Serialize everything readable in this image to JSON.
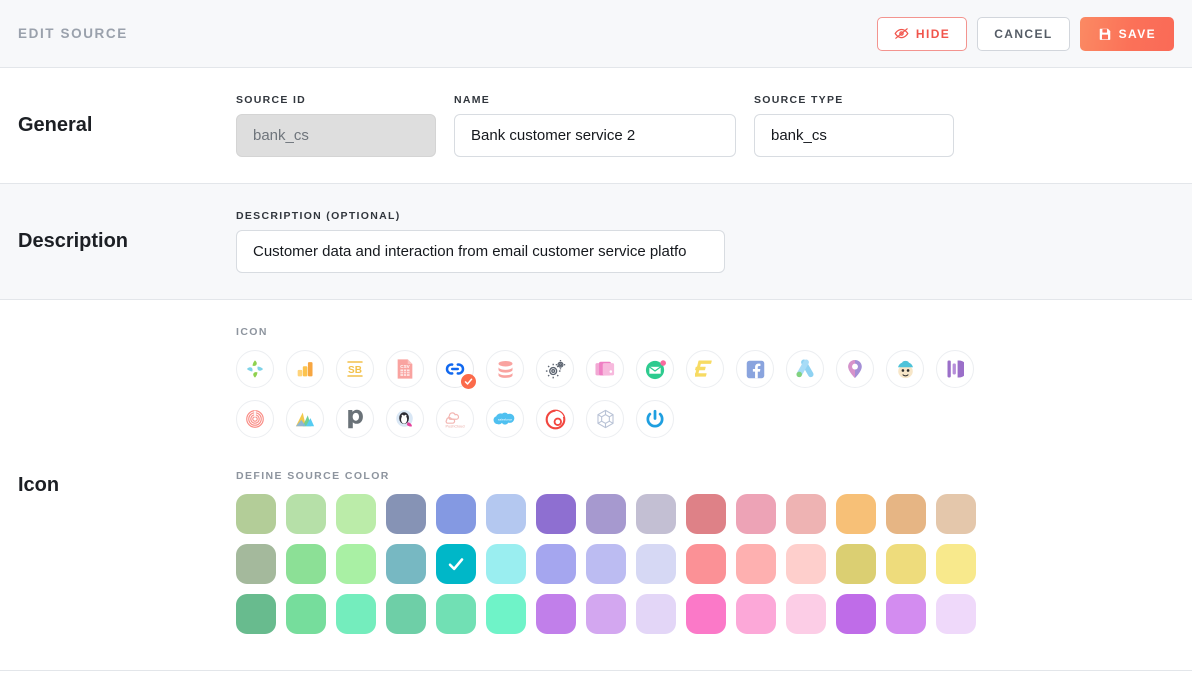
{
  "header": {
    "title": "EDIT SOURCE",
    "buttons": {
      "hide": "HIDE",
      "cancel": "CANCEL",
      "save": "SAVE"
    },
    "icons": {
      "hide": "eye-slash-icon",
      "save": "floppy-disk-icon"
    },
    "colors": {
      "hide_accent": "#f1554c",
      "save_gradient_from": "#fb8a63",
      "save_gradient_to": "#fa6a57"
    }
  },
  "sections": {
    "general": {
      "label": "General",
      "fields": {
        "source_id": {
          "label": "SOURCE ID",
          "value": "bank_cs",
          "disabled": true
        },
        "name": {
          "label": "NAME",
          "value": "Bank customer service 2",
          "disabled": false
        },
        "source_type": {
          "label": "SOURCE TYPE",
          "value": "bank_cs",
          "disabled": false
        }
      }
    },
    "description": {
      "label": "Description",
      "field": {
        "label": "DESCRIPTION (OPTIONAL)",
        "value": "Customer data and interaction from email customer service platfo"
      }
    },
    "icon": {
      "label": "Icon",
      "icon_picker_label": "ICON",
      "color_picker_label": "DEFINE SOURCE COLOR",
      "selected_icon_index": 4,
      "icons": [
        {
          "name": "leaf-cluster-icon",
          "title": "Leaf cluster"
        },
        {
          "name": "bar-chart-icon",
          "title": "Bar chart"
        },
        {
          "name": "sb-letters-icon",
          "title": "SB"
        },
        {
          "name": "csv-file-icon",
          "title": "CSV file"
        },
        {
          "name": "oc-logo-icon",
          "title": "OC logo"
        },
        {
          "name": "database-icon",
          "title": "Database"
        },
        {
          "name": "gears-icon",
          "title": "Gears"
        },
        {
          "name": "cards-stack-icon",
          "title": "Cards stack"
        },
        {
          "name": "envelope-icon",
          "title": "Envelope"
        },
        {
          "name": "e-letter-icon",
          "title": "E letter"
        },
        {
          "name": "facebook-icon",
          "title": "Facebook"
        },
        {
          "name": "google-ads-icon",
          "title": "Google Ads"
        },
        {
          "name": "map-pin-icon",
          "title": "Map pin"
        },
        {
          "name": "mailchimp-icon",
          "title": "Mailchimp"
        },
        {
          "name": "bars-pillar-icon",
          "title": "Pillars"
        },
        {
          "name": "spiral-icon",
          "title": "Spiral"
        },
        {
          "name": "mountain-chart-icon",
          "title": "Mountain chart"
        },
        {
          "name": "pipedrive-p-icon",
          "title": "Pipedrive"
        },
        {
          "name": "prestashop-icon",
          "title": "PrestaShop"
        },
        {
          "name": "pushcloud-icon",
          "title": "PushCloud"
        },
        {
          "name": "salesforce-icon",
          "title": "Salesforce"
        },
        {
          "name": "red-ring-icon",
          "title": "Red ring"
        },
        {
          "name": "hexagon-icon",
          "title": "Hexagon"
        },
        {
          "name": "power-button-icon",
          "title": "Power"
        }
      ],
      "selected_color_index": 19,
      "selected_color": "#00b7c8",
      "colors": [
        "#b3cd98",
        "#b6e0a8",
        "#bbeca9",
        "#8693b5",
        "#8499e2",
        "#b4c8f0",
        "#8e6fd1",
        "#a699cf",
        "#c3bfd3",
        "#de8187",
        "#eda3b6",
        "#eeb3b3",
        "#f7c077",
        "#e6b584",
        "#e4c7ab",
        "#a4b99c",
        "#8ce096",
        "#a9f0a4",
        "#77b8c2",
        "#00b7c8",
        "#9aeef0",
        "#a5a6ef",
        "#bcbcf2",
        "#d6d8f4",
        "#fb9196",
        "#feb0b0",
        "#fecfcc",
        "#dbcf72",
        "#eedc7c",
        "#f8e98c",
        "#68bb8e",
        "#76dd9c",
        "#74edbd",
        "#6ecfa7",
        "#71e0b4",
        "#6ff3c8",
        "#c17fea",
        "#d3a7f0",
        "#e3d6f7",
        "#fb79c8",
        "#fca8d8",
        "#fccde6",
        "#bf6ce8",
        "#d38cf0",
        "#efd9fa"
      ]
    }
  }
}
